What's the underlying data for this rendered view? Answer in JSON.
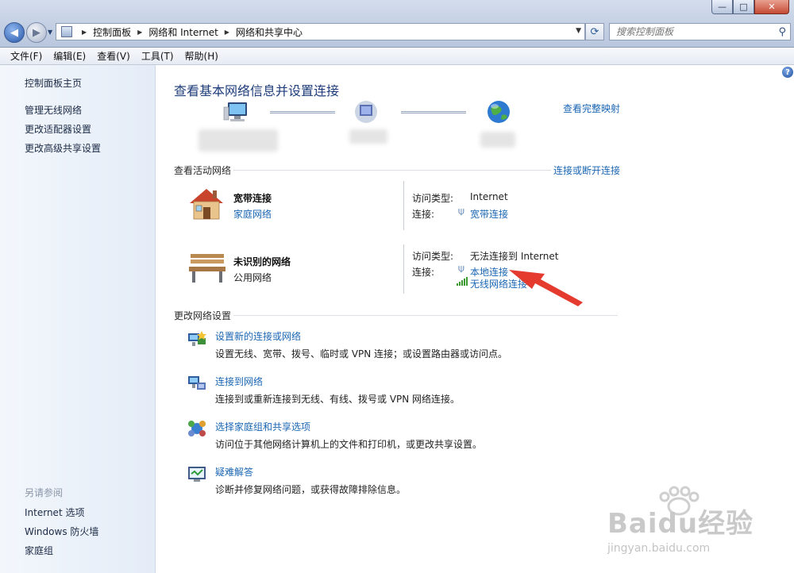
{
  "window": {
    "min_glyph": "—",
    "max_glyph": "□",
    "close_glyph": "✕"
  },
  "addressbar": {
    "segments": [
      "控制面板",
      "网络和 Internet",
      "网络和共享中心"
    ],
    "search_placeholder": "搜索控制面板"
  },
  "menu": {
    "items": [
      "文件(F)",
      "编辑(E)",
      "查看(V)",
      "工具(T)",
      "帮助(H)"
    ]
  },
  "sidebar": {
    "home": "控制面板主页",
    "items": [
      "管理无线网络",
      "更改适配器设置",
      "更改高级共享设置"
    ],
    "see_also_caption": "另请参阅",
    "see_also": [
      "Internet 选项",
      "Windows 防火墙",
      "家庭组"
    ]
  },
  "main": {
    "title": "查看基本网络信息并设置连接",
    "full_map_link": "查看完整映射",
    "active_networks_header": "查看活动网络",
    "connect_disconnect_link": "连接或断开连接",
    "networks": [
      {
        "name": "宽带连接",
        "type": "家庭网络",
        "type_is_link": true,
        "access_label": "访问类型:",
        "access_value": "Internet",
        "conn_label": "连接:",
        "connections": [
          "宽带连接"
        ]
      },
      {
        "name": "未识别的网络",
        "type": "公用网络",
        "type_is_link": false,
        "access_label": "访问类型:",
        "access_value": "无法连接到 Internet",
        "conn_label": "连接:",
        "connections": [
          "本地连接",
          "无线网络连接"
        ]
      }
    ],
    "change_settings_header": "更改网络设置",
    "tasks": [
      {
        "title": "设置新的连接或网络",
        "desc": "设置无线、宽带、拨号、临时或 VPN 连接；或设置路由器或访问点。"
      },
      {
        "title": "连接到网络",
        "desc": "连接到或重新连接到无线、有线、拨号或 VPN 网络连接。"
      },
      {
        "title": "选择家庭组和共享选项",
        "desc": "访问位于其他网络计算机上的文件和打印机，或更改共享设置。"
      },
      {
        "title": "疑难解答",
        "desc": "诊断并修复网络问题，或获得故障排除信息。"
      }
    ]
  },
  "watermark": {
    "brand": "Bai",
    "brand2": "du",
    "brand_cn": "经验",
    "url": "jingyan.baidu.com"
  },
  "colors": {
    "link": "#1b66b3",
    "title": "#1e3d7a",
    "arrow": "#e53b2e"
  }
}
